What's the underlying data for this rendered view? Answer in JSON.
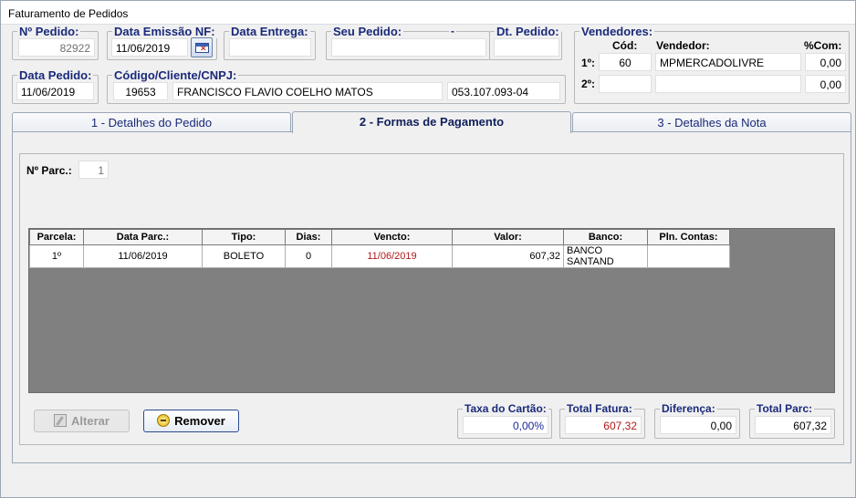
{
  "window": {
    "title": "Faturamento de Pedidos"
  },
  "header": {
    "pedido": {
      "label": "Nº Pedido:",
      "value": "82922"
    },
    "data_emissao": {
      "label": "Data Emissão NF:",
      "value": "11/06/2019"
    },
    "data_entrega": {
      "label": "Data Entrega:",
      "value": ""
    },
    "seu_pedido": {
      "label": "Seu Pedido:",
      "value": "",
      "separator": "-"
    },
    "dt_pedido": {
      "label": "Dt. Pedido:",
      "value": ""
    },
    "data_pedido": {
      "label": "Data Pedido:",
      "value": "11/06/2019"
    },
    "cliente": {
      "label": "Código/Cliente/CNPJ:",
      "codigo": "19653",
      "nome": "FRANCISCO FLAVIO COELHO MATOS",
      "cnpj": "053.107.093-04"
    }
  },
  "vendedores": {
    "label": "Vendedores:",
    "col_cod": "Cód:",
    "col_vendedor": "Vendedor:",
    "col_com": "%Com:",
    "rows": [
      {
        "ordem": "1º:",
        "cod": "60",
        "nome": "MPMERCADOLIVRE",
        "com": "0,00"
      },
      {
        "ordem": "2º:",
        "cod": "",
        "nome": "",
        "com": "0,00"
      }
    ]
  },
  "tabs": [
    {
      "label": "1 - Detalhes do Pedido"
    },
    {
      "label": "2 - Formas de Pagamento"
    },
    {
      "label": "3 - Detalhes da Nota"
    }
  ],
  "parcelas": {
    "label": "Nº Parc.:",
    "value": "1"
  },
  "grid": {
    "columns": [
      "Parcela:",
      "Data Parc.:",
      "Tipo:",
      "Dias:",
      "Vencto:",
      "Valor:",
      "Banco:",
      "Pln. Contas:"
    ],
    "rows": [
      {
        "parcela": "1º",
        "data": "11/06/2019",
        "tipo": "BOLETO",
        "dias": "0",
        "vencto": "11/06/2019",
        "valor": "607,32",
        "banco": "BANCO SANTAND",
        "plano": ""
      }
    ]
  },
  "buttons": {
    "alterar": "Alterar",
    "remover": "Remover"
  },
  "totals": {
    "taxa": {
      "label": "Taxa do Cartão:",
      "value": "0,00%"
    },
    "total_fatura": {
      "label": "Total Fatura:",
      "value": "607,32"
    },
    "diferenca": {
      "label": "Diferença:",
      "value": "0,00"
    },
    "total_parc": {
      "label": "Total Parc:",
      "value": "607,32"
    }
  },
  "colors": {
    "label_blue": "#1a2a7a",
    "vencto_red": "#b01818",
    "value_blue": "#1a2a9a"
  }
}
